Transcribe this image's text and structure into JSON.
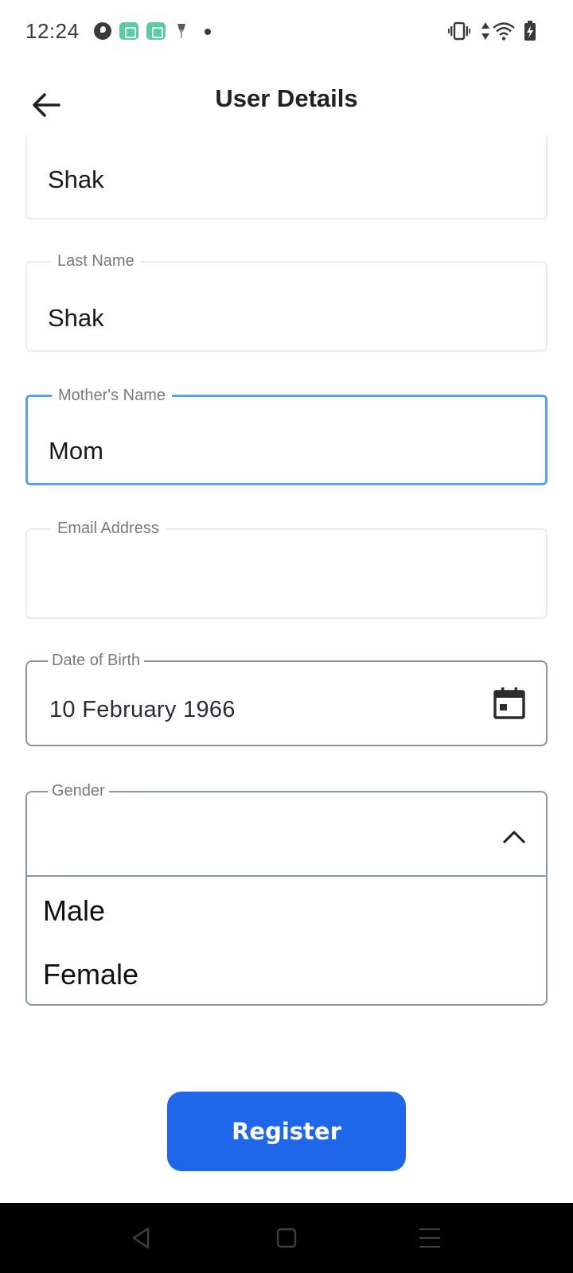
{
  "status_bar": {
    "time": "12:24",
    "left_icons": [
      "app-icon",
      "green-app-icon",
      "green-app-icon",
      "pin-icon",
      "dot-icon"
    ],
    "right_icons": [
      "vibrate-icon",
      "data-arrows-icon",
      "wifi-icon",
      "battery-charging-icon"
    ]
  },
  "app_bar": {
    "title": "User Details",
    "back_icon": "arrow-left-icon"
  },
  "form": {
    "first_name": {
      "value": "Shak"
    },
    "last_name": {
      "label": "Last Name",
      "value": "Shak"
    },
    "mothers_name": {
      "label": "Mother's Name",
      "value": "Mom"
    },
    "email": {
      "label": "Email Address",
      "value": ""
    },
    "date_of_birth": {
      "label": "Date of Birth",
      "value": "10 February 1966",
      "icon": "calendar-icon"
    },
    "gender": {
      "label": "Gender",
      "selected": "",
      "expanded": true,
      "options": [
        "Male",
        "Female"
      ]
    }
  },
  "register_button": {
    "label": "Register"
  },
  "colors": {
    "primary": "#1e67ea",
    "focus_border": "#5aa0ef",
    "field_border": "#e9edf2",
    "outlined_border": "#8a96a6"
  }
}
